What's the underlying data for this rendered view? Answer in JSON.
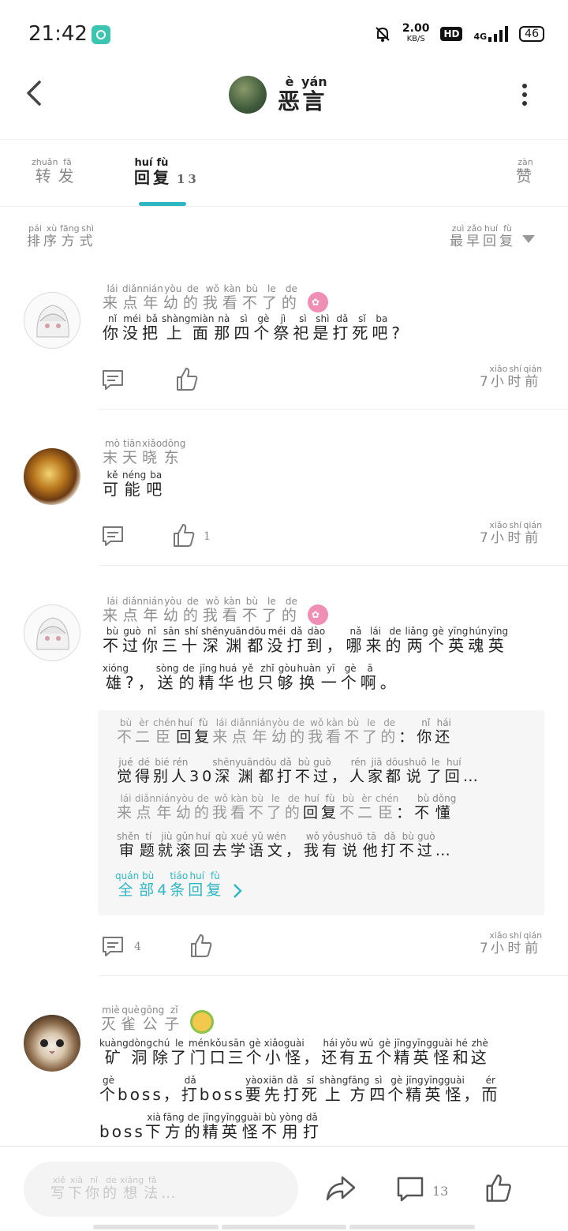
{
  "status_bar": {
    "time": "21:42",
    "net_speed": "2.00",
    "net_unit": "KB/S",
    "hd": "HD",
    "network": "4G",
    "battery": "46"
  },
  "header": {
    "title_chars": [
      [
        "恶",
        "è"
      ],
      [
        "言",
        "yán"
      ]
    ]
  },
  "tabs": [
    {
      "chars": [
        [
          "转",
          "zhuǎn"
        ],
        [
          "发",
          "fā"
        ]
      ]
    },
    {
      "chars": [
        [
          "回",
          "huí"
        ],
        [
          "复",
          "fù"
        ]
      ],
      "count": "13"
    },
    {
      "chars": [
        [
          "赞",
          "zàn"
        ]
      ]
    }
  ],
  "sort": {
    "label": [
      [
        "排",
        "pái"
      ],
      [
        "序",
        "xù"
      ],
      [
        "方",
        "fāng"
      ],
      [
        "式",
        "shì"
      ]
    ],
    "value": [
      [
        "最",
        "zuì"
      ],
      [
        "早",
        "zǎo"
      ],
      [
        "回",
        "huí"
      ],
      [
        "复",
        "fù"
      ]
    ]
  },
  "comments": [
    {
      "user": [
        [
          "来",
          "lái"
        ],
        [
          "点",
          "diǎn"
        ],
        [
          "年",
          "nián"
        ],
        [
          "幼",
          "yòu"
        ],
        [
          "的",
          "de"
        ],
        [
          "我",
          "wǒ"
        ],
        [
          "看",
          "kàn"
        ],
        [
          "不",
          "bù"
        ],
        [
          "了",
          "le"
        ],
        [
          "的",
          "de"
        ]
      ],
      "badge": "pink",
      "lines": [
        [
          [
            "你",
            "nǐ"
          ],
          [
            "没",
            "méi"
          ],
          [
            "把",
            "bǎ"
          ],
          [
            "上",
            "shàng"
          ],
          [
            "面",
            "miàn"
          ],
          [
            "那",
            "nà"
          ],
          [
            "四",
            "sì"
          ],
          [
            "个",
            "gè"
          ],
          [
            "祭",
            "jì"
          ],
          [
            "祀",
            "sì"
          ],
          [
            "是",
            "shì"
          ],
          [
            "打",
            "dǎ"
          ],
          [
            "死",
            "sǐ"
          ],
          [
            "吧",
            "ba"
          ],
          [
            "?",
            ""
          ]
        ]
      ],
      "time": [
        [
          "7",
          ""
        ],
        [
          "小",
          "xiǎo"
        ],
        [
          "时",
          "shí"
        ],
        [
          "前",
          "qián"
        ]
      ],
      "reply_count": "",
      "like_count": ""
    },
    {
      "user": [
        [
          "末",
          "mò"
        ],
        [
          "天",
          "tiān"
        ],
        [
          "晓",
          "xiǎo"
        ],
        [
          "东",
          "dōng"
        ]
      ],
      "badge": "",
      "lines": [
        [
          [
            "可",
            "kě"
          ],
          [
            "能",
            "néng"
          ],
          [
            "吧",
            "ba"
          ]
        ]
      ],
      "time": [
        [
          "7",
          ""
        ],
        [
          "小",
          "xiǎo"
        ],
        [
          "时",
          "shí"
        ],
        [
          "前",
          "qián"
        ]
      ],
      "reply_count": "",
      "like_count": "1"
    },
    {
      "user": [
        [
          "来",
          "lái"
        ],
        [
          "点",
          "diǎn"
        ],
        [
          "年",
          "nián"
        ],
        [
          "幼",
          "yòu"
        ],
        [
          "的",
          "de"
        ],
        [
          "我",
          "wǒ"
        ],
        [
          "看",
          "kàn"
        ],
        [
          "不",
          "bù"
        ],
        [
          "了",
          "le"
        ],
        [
          "的",
          "de"
        ]
      ],
      "badge": "pink",
      "lines": [
        [
          [
            "不",
            "bù"
          ],
          [
            "过",
            "guò"
          ],
          [
            "你",
            "nǐ"
          ],
          [
            "三",
            "sān"
          ],
          [
            "十",
            "shí"
          ],
          [
            "深",
            "shēn"
          ],
          [
            "渊",
            "yuān"
          ],
          [
            "都",
            "dōu"
          ],
          [
            "没",
            "méi"
          ],
          [
            "打",
            "dǎ"
          ],
          [
            "到",
            "dào"
          ],
          [
            "，",
            ""
          ],
          [
            "哪",
            "nǎ"
          ],
          [
            "来",
            "lái"
          ],
          [
            "的",
            "de"
          ],
          [
            "两",
            "liǎng"
          ],
          [
            "个",
            "gè"
          ],
          [
            "英",
            "yīng"
          ],
          [
            "魂",
            "hún"
          ],
          [
            "英",
            "yīng"
          ]
        ],
        [
          [
            "雄",
            "xióng"
          ],
          [
            "?",
            ""
          ],
          [
            "，",
            ""
          ],
          [
            "送",
            "sòng"
          ],
          [
            "的",
            "de"
          ],
          [
            "精",
            "jīng"
          ],
          [
            "华",
            "huá"
          ],
          [
            "也",
            "yě"
          ],
          [
            "只",
            "zhǐ"
          ],
          [
            "够",
            "gòu"
          ],
          [
            "换",
            "huàn"
          ],
          [
            "一",
            "yī"
          ],
          [
            "个",
            "gè"
          ],
          [
            "啊",
            "ā"
          ],
          [
            "。",
            ""
          ]
        ]
      ],
      "replies": [
        [
          [
            [
              "不",
              "bù"
            ],
            [
              "二",
              "èr"
            ],
            [
              "臣",
              "chén"
            ]
          ],
          [
            [
              "回",
              "huí"
            ],
            [
              "复",
              "fù"
            ]
          ],
          [
            [
              "来",
              "lái"
            ],
            [
              "点",
              "diǎn"
            ],
            [
              "年",
              "nián"
            ],
            [
              "幼",
              "yòu"
            ],
            [
              "的",
              "de"
            ],
            [
              "我",
              "wǒ"
            ],
            [
              "看",
              "kàn"
            ],
            [
              "不",
              "bù"
            ],
            [
              "了",
              "le"
            ],
            [
              "的",
              "de"
            ]
          ],
          [
            [
              "：",
              ""
            ],
            [
              "你",
              "nǐ"
            ],
            [
              "还",
              "hái"
            ]
          ],
          [
            [
              "觉",
              "jué"
            ],
            [
              "得",
              "dé"
            ],
            [
              "别",
              "bié"
            ],
            [
              "人",
              "rén"
            ],
            [
              "30",
              ""
            ],
            [
              "深",
              "shēn"
            ],
            [
              "渊",
              "yuān"
            ],
            [
              "都",
              "dōu"
            ],
            [
              "打",
              "dǎ"
            ],
            [
              "不",
              "bù"
            ],
            [
              "过",
              "guò"
            ],
            [
              "，",
              ""
            ],
            [
              "人",
              "rén"
            ],
            [
              "家",
              "jiā"
            ],
            [
              "都",
              "dōu"
            ],
            [
              "说",
              "shuō"
            ],
            [
              "了",
              "le"
            ],
            [
              "回",
              "huí"
            ],
            [
              "…",
              ""
            ]
          ]
        ],
        [
          [
            [
              "来",
              "lái"
            ],
            [
              "点",
              "diǎn"
            ],
            [
              "年",
              "nián"
            ],
            [
              "幼",
              "yòu"
            ],
            [
              "的",
              "de"
            ],
            [
              "我",
              "wǒ"
            ],
            [
              "看",
              "kàn"
            ],
            [
              "不",
              "bù"
            ],
            [
              "了",
              "le"
            ],
            [
              "的",
              "de"
            ]
          ],
          [
            [
              "回",
              "huí"
            ],
            [
              "复",
              "fù"
            ]
          ],
          [
            [
              "不",
              "bù"
            ],
            [
              "二",
              "èr"
            ],
            [
              "臣",
              "chén"
            ]
          ],
          [
            [
              "：",
              ""
            ],
            [
              "不",
              "bù"
            ],
            [
              "懂",
              "dǒng"
            ]
          ],
          [
            [
              "审",
              "shěn"
            ],
            [
              "题",
              "tí"
            ],
            [
              "就",
              "jiù"
            ],
            [
              "滚",
              "gǔn"
            ],
            [
              "回",
              "huí"
            ],
            [
              "去",
              "qù"
            ],
            [
              "学",
              "xué"
            ],
            [
              "语",
              "yǔ"
            ],
            [
              "文",
              "wén"
            ],
            [
              "，",
              ""
            ],
            [
              "我",
              "wǒ"
            ],
            [
              "有",
              "yǒu"
            ],
            [
              "说",
              "shuō"
            ],
            [
              "他",
              "tā"
            ],
            [
              "打",
              "dǎ"
            ],
            [
              "不",
              "bù"
            ],
            [
              "过",
              "guò"
            ],
            [
              "…",
              ""
            ]
          ]
        ]
      ],
      "more_replies": [
        [
          "全",
          "quán"
        ],
        [
          "部",
          "bù"
        ],
        [
          "4",
          ""
        ],
        [
          "条",
          "tiáo"
        ],
        [
          "回",
          "huí"
        ],
        [
          "复",
          "fù"
        ]
      ],
      "time": [
        [
          "7",
          ""
        ],
        [
          "小",
          "xiǎo"
        ],
        [
          "时",
          "shí"
        ],
        [
          "前",
          "qián"
        ]
      ],
      "reply_count": "4",
      "like_count": ""
    },
    {
      "user": [
        [
          "灭",
          "miè"
        ],
        [
          "雀",
          "què"
        ],
        [
          "公",
          "gōng"
        ],
        [
          "子",
          "zǐ"
        ]
      ],
      "badge": "green",
      "lines": [
        [
          [
            "矿",
            "kuàng"
          ],
          [
            "洞",
            "dòng"
          ],
          [
            "除",
            "chú"
          ],
          [
            "了",
            "le"
          ],
          [
            "门",
            "mén"
          ],
          [
            "口",
            "kǒu"
          ],
          [
            "三",
            "sān"
          ],
          [
            "个",
            "gè"
          ],
          [
            "小",
            "xiǎo"
          ],
          [
            "怪",
            "guài"
          ],
          [
            "，",
            ""
          ],
          [
            "还",
            "hái"
          ],
          [
            "有",
            "yǒu"
          ],
          [
            "五",
            "wǔ"
          ],
          [
            "个",
            "gè"
          ],
          [
            "精",
            "jīng"
          ],
          [
            "英",
            "yīng"
          ],
          [
            "怪",
            "guài"
          ],
          [
            "和",
            "hé"
          ],
          [
            "这",
            "zhè"
          ]
        ],
        [
          [
            "个",
            "gè"
          ],
          [
            "boss",
            ""
          ],
          [
            "，",
            ""
          ],
          [
            "打",
            "dǎ"
          ],
          [
            "boss",
            ""
          ],
          [
            "要",
            "yào"
          ],
          [
            "先",
            "xiān"
          ],
          [
            "打",
            "dǎ"
          ],
          [
            "死",
            "sǐ"
          ],
          [
            "上",
            "shàng"
          ],
          [
            "方",
            "fāng"
          ],
          [
            "四",
            "sì"
          ],
          [
            "个",
            "gè"
          ],
          [
            "精",
            "jīng"
          ],
          [
            "英",
            "yīng"
          ],
          [
            "怪",
            "guài"
          ],
          [
            "，",
            ""
          ],
          [
            "而",
            "ér"
          ]
        ],
        [
          [
            "boss",
            ""
          ],
          [
            "下",
            "xià"
          ],
          [
            "方",
            "fāng"
          ],
          [
            "的",
            "de"
          ],
          [
            "精",
            "jīng"
          ],
          [
            "英",
            "yīng"
          ],
          [
            "怪",
            "guài"
          ],
          [
            "不",
            "bù"
          ],
          [
            "用",
            "yòng"
          ],
          [
            "打",
            "dǎ"
          ]
        ]
      ]
    }
  ],
  "bottom_bar": {
    "placeholder": [
      [
        "写",
        "xiě"
      ],
      [
        "下",
        "xià"
      ],
      [
        "你",
        "nǐ"
      ],
      [
        "的",
        "de"
      ],
      [
        "想",
        "xiǎng"
      ],
      [
        "法",
        "fǎ"
      ],
      [
        "…",
        ""
      ]
    ],
    "comment_count": "13"
  },
  "colors": {
    "accent": "#2eb6c3",
    "badge_pink": "#f08fb5",
    "reply_bg": "#f6f6f6"
  }
}
